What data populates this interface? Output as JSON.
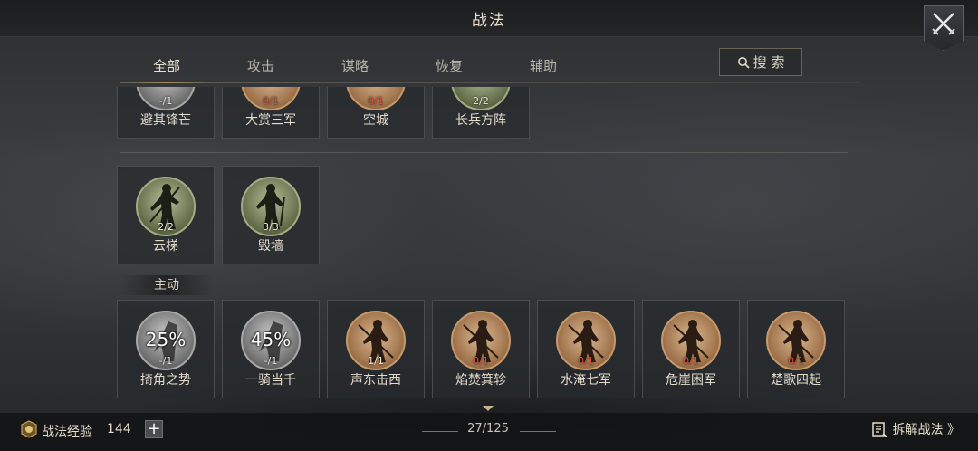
{
  "header": {
    "title": "战法"
  },
  "tabs": [
    {
      "label": "全部",
      "active": true
    },
    {
      "label": "攻击"
    },
    {
      "label": "谋略"
    },
    {
      "label": "恢复"
    },
    {
      "label": "辅助"
    }
  ],
  "search": {
    "label": "搜 索"
  },
  "row_top": [
    {
      "name": "避其锋芒",
      "count": "-/1",
      "style": "gray"
    },
    {
      "name": "大赏三军",
      "count": "0/1",
      "style": "bronze"
    },
    {
      "name": "空城",
      "count": "0/1",
      "style": "bronze"
    },
    {
      "name": "长兵方阵",
      "count": "2/2",
      "style": "green"
    }
  ],
  "row_mid": [
    {
      "name": "云梯",
      "count": "2/2",
      "style": "green"
    },
    {
      "name": "毁墙",
      "count": "3/3",
      "style": "green"
    }
  ],
  "section_active": "主动",
  "row_active": [
    {
      "name": "掎角之势",
      "count": "-/1",
      "percent": "25%",
      "style": "gray"
    },
    {
      "name": "一骑当千",
      "count": "-/1",
      "percent": "45%",
      "style": "gray"
    },
    {
      "name": "声东击西",
      "count": "1/1",
      "style": "bronze"
    },
    {
      "name": "焰焚箕轸",
      "count": "0/1",
      "style": "bronze"
    },
    {
      "name": "水淹七军",
      "count": "0/1",
      "style": "bronze"
    },
    {
      "name": "危崖困军",
      "count": "0/1",
      "style": "bronze"
    },
    {
      "name": "楚歌四起",
      "count": "0/1",
      "style": "bronze"
    }
  ],
  "footer": {
    "exp_label": "战法经验",
    "exp_value": "144",
    "plus": "+",
    "page": "27/125",
    "disassemble": "拆解战法 》"
  }
}
